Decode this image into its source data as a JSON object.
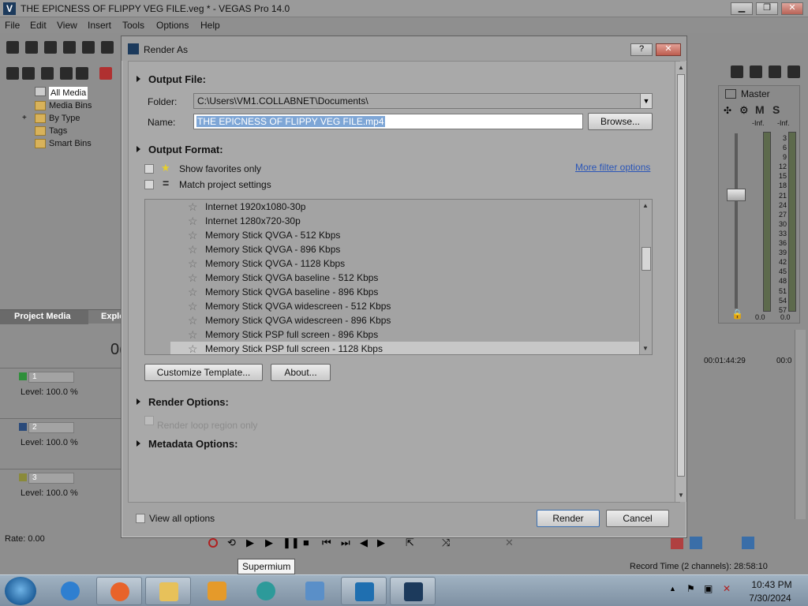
{
  "window": {
    "title": "THE EPICNESS OF FLIPPY VEG FILE.veg * - VEGAS Pro 14.0",
    "controls": [
      "minimize",
      "restore",
      "close"
    ]
  },
  "menu": [
    "File",
    "Edit",
    "View",
    "Insert",
    "Tools",
    "Options",
    "Help"
  ],
  "media_panel": {
    "tree": [
      "All Media",
      "Media Bins",
      "By Type",
      "Tags",
      "Smart Bins"
    ],
    "tabs": [
      "Project Media",
      "Explo"
    ]
  },
  "tracks": [
    {
      "number": "1",
      "level": "Level: 100.0 %",
      "color": "#2f8f3a"
    },
    {
      "number": "2",
      "level": "Level: 100.0 %",
      "color": "#2a4a7a"
    },
    {
      "number": "3",
      "level": "Level: 100.0 %",
      "color": "#8a8a3a"
    }
  ],
  "rate": "Rate: 0.00",
  "master": {
    "label": "Master",
    "m": "M",
    "s": "S",
    "inf_left": "-Inf.",
    "inf_right": "-Inf.",
    "scale": [
      "3",
      "6",
      "9",
      "12",
      "15",
      "18",
      "21",
      "24",
      "27",
      "30",
      "33",
      "36",
      "39",
      "42",
      "45",
      "48",
      "51",
      "54",
      "57"
    ],
    "bottom_left": "0.0",
    "bottom_right": "0.0"
  },
  "timeline": {
    "tc1": "00:01:44:29",
    "tc2": "00:0"
  },
  "record_time": "Record Time (2 channels): 28:58:10",
  "dialog": {
    "title": "Render As",
    "help": "?",
    "output_file": {
      "heading": "Output File:",
      "folder_label": "Folder:",
      "folder_value": "C:\\Users\\VM1.COLLABNET\\Documents\\",
      "name_label": "Name:",
      "name_value": "THE EPICNESS OF FLIPPY VEG FILE.mp4",
      "browse": "Browse..."
    },
    "output_format": {
      "heading": "Output Format:",
      "show_favorites": "Show favorites only",
      "match_project": "Match project settings",
      "more_filter": "More filter options",
      "templates": [
        "Internet 1920x1080-30p",
        "Internet 1280x720-30p",
        "Memory Stick QVGA - 512 Kbps",
        "Memory Stick QVGA - 896 Kbps",
        "Memory Stick QVGA - 1128 Kbps",
        "Memory Stick QVGA baseline - 512 Kbps",
        "Memory Stick QVGA baseline - 896 Kbps",
        "Memory Stick QVGA widescreen - 512 Kbps",
        "Memory Stick QVGA widescreen - 896 Kbps",
        "Memory Stick PSP full screen - 896 Kbps",
        "Memory Stick PSP full screen - 1128 Kbps"
      ],
      "selected_index": 10,
      "customize": "Customize Template...",
      "about": "About..."
    },
    "render_options": {
      "heading": "Render Options:",
      "loop_region": "Render loop region only"
    },
    "metadata": {
      "heading": "Metadata Options:"
    },
    "view_all": "View all options",
    "render_btn": "Render",
    "cancel_btn": "Cancel"
  },
  "taskbar": {
    "tooltip": "Supermium",
    "time": "10:43 PM",
    "date": "7/30/2024"
  }
}
